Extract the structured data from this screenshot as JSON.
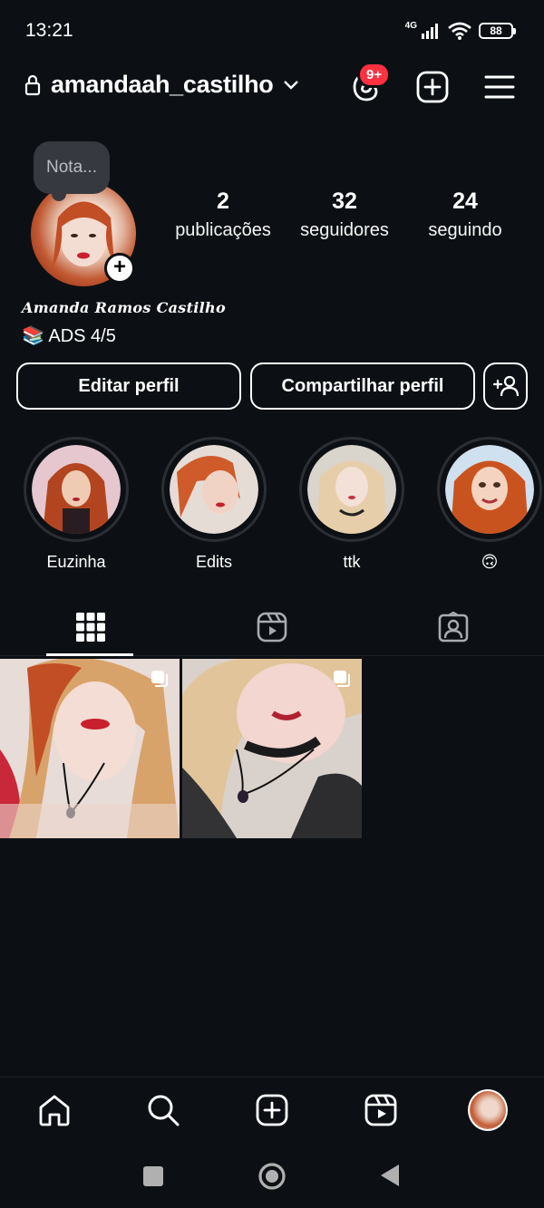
{
  "status": {
    "time": "13:21",
    "network": "4G",
    "battery": "88"
  },
  "header": {
    "username": "amandaah_castilho",
    "notification_count": "9+"
  },
  "profile": {
    "note": "Nota...",
    "stats": [
      {
        "value": "2",
        "label": "publicações"
      },
      {
        "value": "32",
        "label": "seguidores"
      },
      {
        "value": "24",
        "label": "seguindo"
      }
    ],
    "full_name": "Amanda Ramos Castilho",
    "bio": "📚 ADS 4/5"
  },
  "buttons": {
    "edit": "Editar perfil",
    "share": "Compartilhar perfil"
  },
  "highlights": [
    {
      "label": "Euzinha"
    },
    {
      "label": "Edits"
    },
    {
      "label": "ttk"
    },
    {
      "label": "🙃"
    }
  ],
  "tabs": [
    {
      "icon": "grid-icon",
      "active": true
    },
    {
      "icon": "reels-icon",
      "active": false
    },
    {
      "icon": "tagged-icon",
      "active": false
    }
  ],
  "posts": [
    {
      "type": "carousel"
    },
    {
      "type": "carousel"
    }
  ],
  "bottom_nav": [
    "home-icon",
    "search-icon",
    "create-icon",
    "reels-icon",
    "profile-avatar"
  ],
  "colors": {
    "background": "#0c1014",
    "badge": "#ff3040",
    "note_bubble": "#363a40",
    "text": "#f5f5f5"
  }
}
